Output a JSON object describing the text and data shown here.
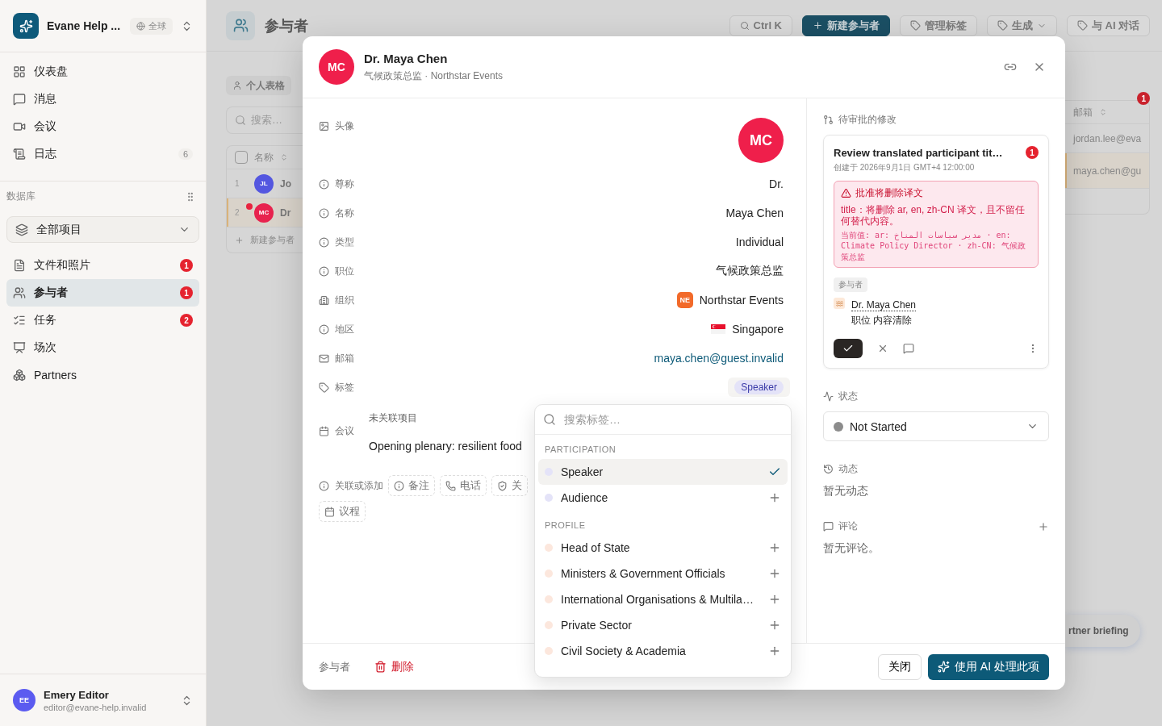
{
  "sidebar": {
    "name": "Evane Help ...",
    "scope": "全球",
    "nav": [
      {
        "label": "仪表盘"
      },
      {
        "label": "消息"
      },
      {
        "label": "会议"
      },
      {
        "label": "日志",
        "count": "6"
      }
    ],
    "database": {
      "title": "数据库",
      "scope": "全部项目",
      "items": [
        {
          "label": "文件和照片",
          "badge": "1",
          "selected": false
        },
        {
          "label": "参与者",
          "badge": "1",
          "selected": true
        },
        {
          "label": "任务",
          "badge": "2",
          "selected": false
        },
        {
          "label": "场次",
          "selected": false
        },
        {
          "label": "Partners",
          "selected": false
        }
      ]
    },
    "user": {
      "initials": "EE",
      "name": "Emery Editor",
      "email": "editor@evane-help.invalid"
    }
  },
  "page": {
    "title": "参与者",
    "search_hint": "Ctrl K",
    "actions": [
      {
        "label": "新建参与者",
        "kind": "primary"
      },
      {
        "label": "管理标签",
        "kind": "tag"
      },
      {
        "label": "生成",
        "kind": "menu"
      },
      {
        "label": "与 AI 对话",
        "kind": "chat"
      }
    ],
    "view": "个人表格",
    "search": {
      "placeholder": "搜索…"
    },
    "notice_badge": "1",
    "table": {
      "select_all": {
        "checked": false
      },
      "columns": [
        "名称",
        "邮箱"
      ],
      "rows": [
        {
          "index": "1",
          "initials": "JL",
          "color": "#5457e0",
          "name": "Jo",
          "email": "jordan.lee@eva",
          "selected": false,
          "unread": false
        },
        {
          "index": "2",
          "initials": "MC",
          "color": "#e8234e",
          "name": "Dr",
          "email": "maya.chen@gu",
          "selected": true,
          "unread": true
        }
      ],
      "add_label": "新建参与者"
    },
    "floating_button": "rtner briefing"
  },
  "modal": {
    "initials": "MC",
    "name": "Dr. Maya Chen",
    "subtitle": "气候政策总监 · Northstar Events",
    "fields": [
      {
        "kind": "avatar",
        "label": "头像",
        "initials": "MC"
      },
      {
        "kind": "text",
        "label": "尊称",
        "value": "Dr."
      },
      {
        "kind": "text",
        "label": "名称",
        "value": "Maya Chen"
      },
      {
        "kind": "text",
        "label": "类型",
        "value": "Individual"
      },
      {
        "kind": "text",
        "label": "职位",
        "value": "气候政策总监"
      },
      {
        "kind": "org",
        "label": "组织",
        "badge": "NE",
        "value": "Northstar Events"
      },
      {
        "kind": "flag",
        "label": "地区",
        "value": "Singapore"
      },
      {
        "kind": "link",
        "label": "邮箱",
        "value": "maya.chen@guest.invalid"
      },
      {
        "kind": "tags",
        "label": "标签",
        "tags": [
          "Speaker"
        ]
      }
    ],
    "meeting": {
      "label": "会议",
      "status": "未关联项目",
      "item": "Opening plenary: resilient food"
    },
    "link_add": {
      "label": "关联或添加",
      "chips": [
        "备注",
        "电话",
        "关",
        "议程"
      ]
    },
    "tag_picker": {
      "search": {
        "placeholder": "搜索标签…"
      },
      "groups": [
        {
          "title": "PARTICIPATION",
          "color": "#e4e3f8",
          "options": [
            {
              "label": "Speaker",
              "selected": true
            },
            {
              "label": "Audience",
              "selected": false
            }
          ]
        },
        {
          "title": "PROFILE",
          "color": "#fce7dd",
          "options": [
            {
              "label": "Head of State",
              "selected": false
            },
            {
              "label": "Ministers & Government Officials",
              "selected": false
            },
            {
              "label": "International Organisations & Multila…",
              "selected": false
            },
            {
              "label": "Private Sector",
              "selected": false
            },
            {
              "label": "Civil Society & Academia",
              "selected": false
            }
          ]
        }
      ]
    },
    "review": {
      "title": "待审批的修改",
      "card": {
        "title": "Review translated participant tit…",
        "badge": "1",
        "created": "创建于 2026年9月1日 GMT+4 12:00:00",
        "warning": {
          "title": "批准将删除译文",
          "body": "title：将删除 ar, en, zh-CN 译文，且不留任何替代内容。",
          "current": "当前值: ar: مدير سياسات المناخ · en: Climate Policy Director · zh-CN: 气候政策总监"
        },
        "entity_type": "参与者",
        "entity": "Dr. Maya Chen",
        "change": "职位 内容清除"
      }
    },
    "status": {
      "label": "状态",
      "value": "Not Started",
      "color": "#8c8c8c"
    },
    "activity": {
      "label": "动态",
      "empty": "暂无动态"
    },
    "comments": {
      "label": "评论",
      "empty": "暂无评论。"
    },
    "footer": {
      "entity": "参与者",
      "delete": "删除",
      "close": "关闭",
      "ai": "使用 AI 处理此项"
    }
  }
}
